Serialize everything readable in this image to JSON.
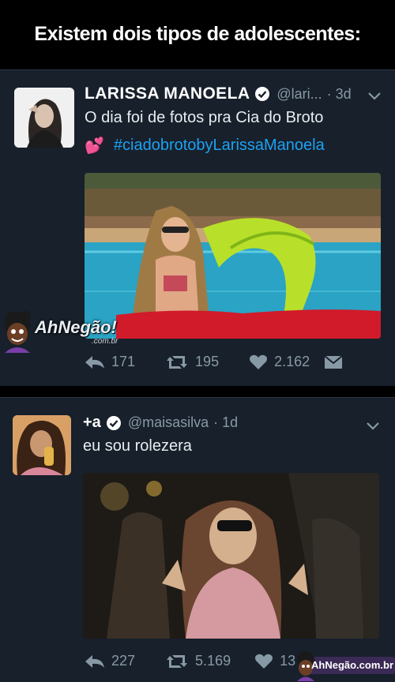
{
  "header": {
    "title": "Existem dois tipos de adolescentes:"
  },
  "tweet1": {
    "display_name": "LARISSA MANOELA",
    "handle": "@lari...",
    "time": "· 3d",
    "text": "O dia foi de fotos pra Cia do Broto",
    "emoji": "💕",
    "hashtag": "#ciadobrotobyLarissaManoela",
    "replies": "171",
    "retweets": "195",
    "likes": "2.162"
  },
  "tweet2": {
    "display_name": "+a",
    "handle": "@maisasilva",
    "time": "· 1d",
    "text": "eu sou rolezera",
    "replies": "227",
    "retweets": "5.169",
    "likes": "13"
  },
  "watermark": {
    "main": "AhNegão!",
    "sub": ".com.br",
    "footer": "AhNegão.com.br"
  },
  "colors": {
    "background": "#17202b",
    "link": "#1da1f2",
    "muted": "#8899a6",
    "pool": "#29a8c9",
    "float_green": "#b8e02a",
    "float_red": "#d11a2a"
  },
  "icons": [
    "verified-badge-icon",
    "chevron-down-icon",
    "reply-icon",
    "retweet-icon",
    "like-heart-icon",
    "direct-message-icon"
  ]
}
